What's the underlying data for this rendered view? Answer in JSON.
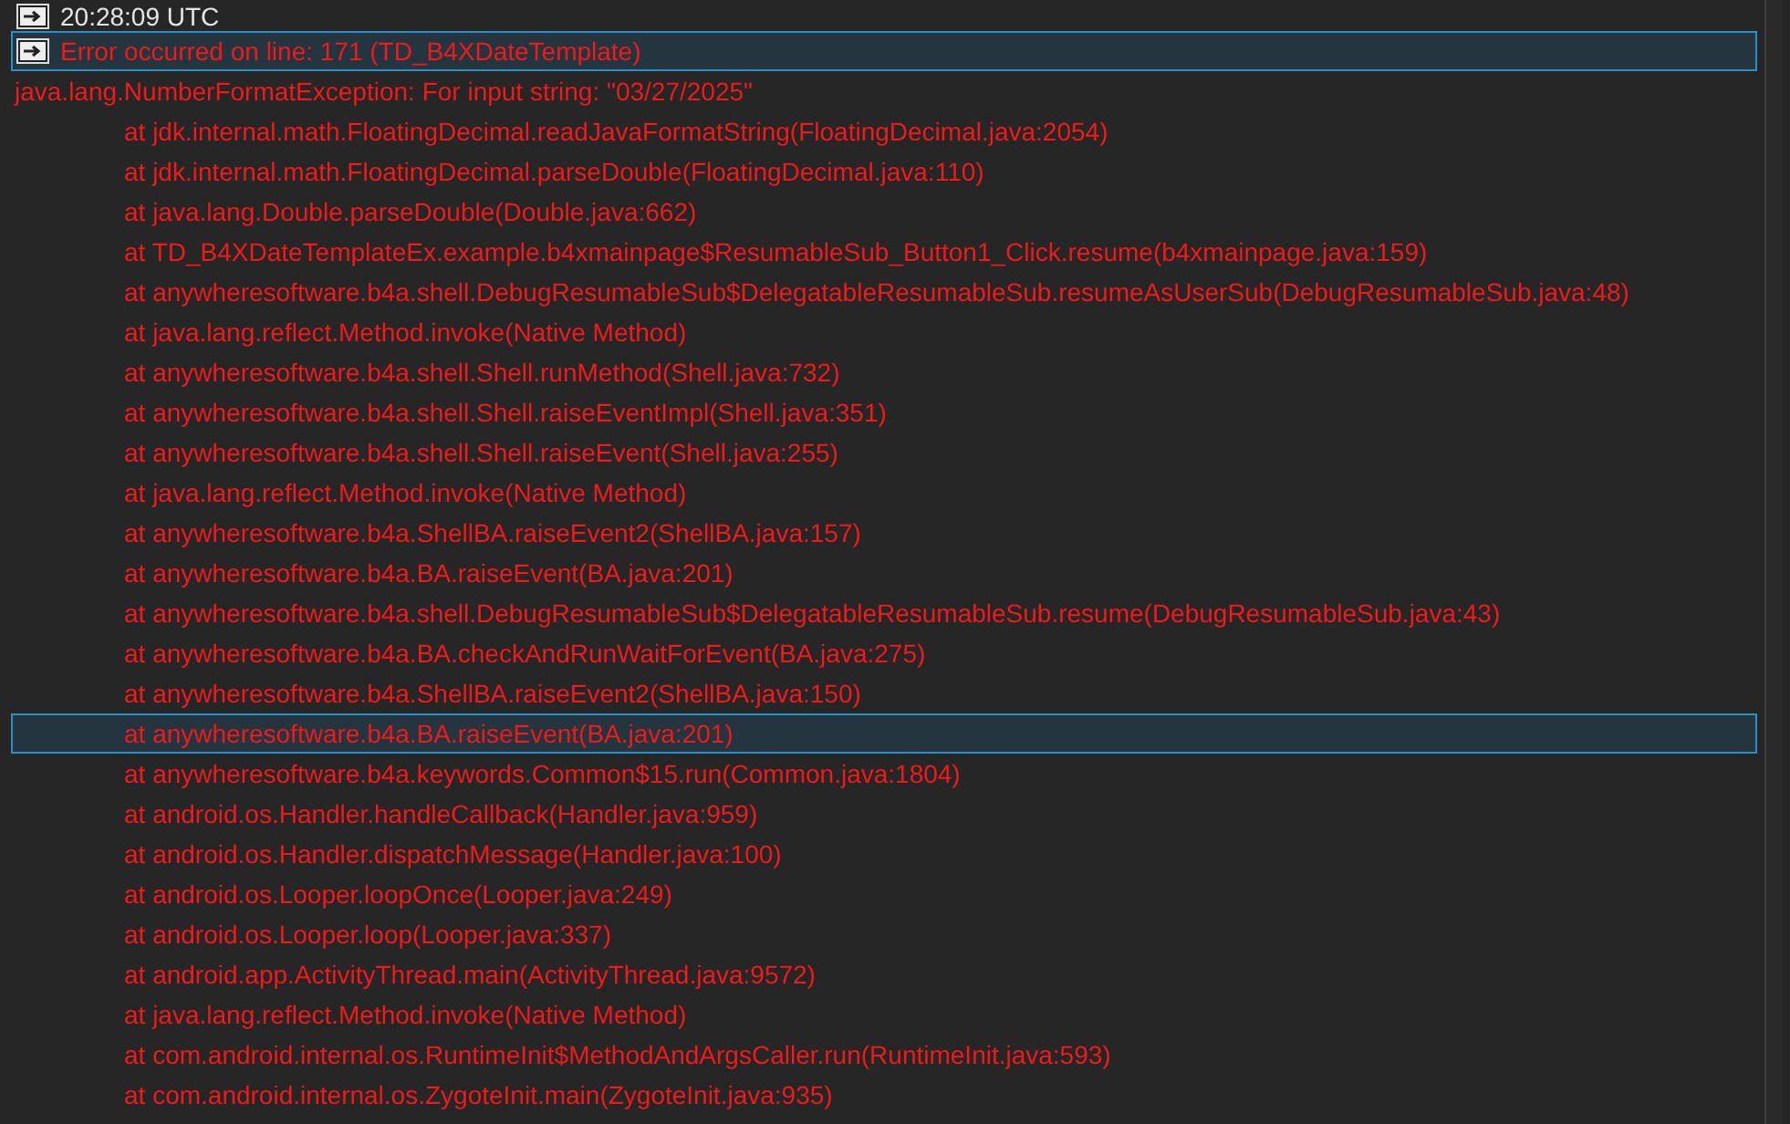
{
  "log": [
    {
      "kind": "time",
      "text": "20:28:09 UTC",
      "selected": false
    },
    {
      "kind": "error",
      "text": "Error occurred on line: 171 (TD_B4XDateTemplate)",
      "selected": true
    },
    {
      "kind": "exception",
      "text": "java.lang.NumberFormatException: For input string: \"03/27/2025\"",
      "selected": false
    },
    {
      "kind": "frame",
      "text": "at jdk.internal.math.FloatingDecimal.readJavaFormatString(FloatingDecimal.java:2054)",
      "selected": false
    },
    {
      "kind": "frame",
      "text": "at jdk.internal.math.FloatingDecimal.parseDouble(FloatingDecimal.java:110)",
      "selected": false
    },
    {
      "kind": "frame",
      "text": "at java.lang.Double.parseDouble(Double.java:662)",
      "selected": false
    },
    {
      "kind": "frame",
      "text": "at TD_B4XDateTemplateEx.example.b4xmainpage$ResumableSub_Button1_Click.resume(b4xmainpage.java:159)",
      "selected": false
    },
    {
      "kind": "frame",
      "text": "at anywheresoftware.b4a.shell.DebugResumableSub$DelegatableResumableSub.resumeAsUserSub(DebugResumableSub.java:48)",
      "selected": false
    },
    {
      "kind": "frame",
      "text": "at java.lang.reflect.Method.invoke(Native Method)",
      "selected": false
    },
    {
      "kind": "frame",
      "text": "at anywheresoftware.b4a.shell.Shell.runMethod(Shell.java:732)",
      "selected": false
    },
    {
      "kind": "frame",
      "text": "at anywheresoftware.b4a.shell.Shell.raiseEventImpl(Shell.java:351)",
      "selected": false
    },
    {
      "kind": "frame",
      "text": "at anywheresoftware.b4a.shell.Shell.raiseEvent(Shell.java:255)",
      "selected": false
    },
    {
      "kind": "frame",
      "text": "at java.lang.reflect.Method.invoke(Native Method)",
      "selected": false
    },
    {
      "kind": "frame",
      "text": "at anywheresoftware.b4a.ShellBA.raiseEvent2(ShellBA.java:157)",
      "selected": false
    },
    {
      "kind": "frame",
      "text": "at anywheresoftware.b4a.BA.raiseEvent(BA.java:201)",
      "selected": false
    },
    {
      "kind": "frame",
      "text": "at anywheresoftware.b4a.shell.DebugResumableSub$DelegatableResumableSub.resume(DebugResumableSub.java:43)",
      "selected": false
    },
    {
      "kind": "frame",
      "text": "at anywheresoftware.b4a.BA.checkAndRunWaitForEvent(BA.java:275)",
      "selected": false
    },
    {
      "kind": "frame",
      "text": "at anywheresoftware.b4a.ShellBA.raiseEvent2(ShellBA.java:150)",
      "selected": false
    },
    {
      "kind": "frame",
      "text": "at anywheresoftware.b4a.BA.raiseEvent(BA.java:201)",
      "selected": true
    },
    {
      "kind": "frame",
      "text": "at anywheresoftware.b4a.keywords.Common$15.run(Common.java:1804)",
      "selected": false
    },
    {
      "kind": "frame",
      "text": "at android.os.Handler.handleCallback(Handler.java:959)",
      "selected": false
    },
    {
      "kind": "frame",
      "text": "at android.os.Handler.dispatchMessage(Handler.java:100)",
      "selected": false
    },
    {
      "kind": "frame",
      "text": "at android.os.Looper.loopOnce(Looper.java:249)",
      "selected": false
    },
    {
      "kind": "frame",
      "text": "at android.os.Looper.loop(Looper.java:337)",
      "selected": false
    },
    {
      "kind": "frame",
      "text": "at android.app.ActivityThread.main(ActivityThread.java:9572)",
      "selected": false
    },
    {
      "kind": "frame",
      "text": "at java.lang.reflect.Method.invoke(Native Method)",
      "selected": false
    },
    {
      "kind": "frame",
      "text": "at com.android.internal.os.RuntimeInit$MethodAndArgsCaller.run(RuntimeInit.java:593)",
      "selected": false
    },
    {
      "kind": "frame",
      "text": "at com.android.internal.os.ZygoteInit.main(ZygoteInit.java:935)",
      "selected": false
    }
  ]
}
